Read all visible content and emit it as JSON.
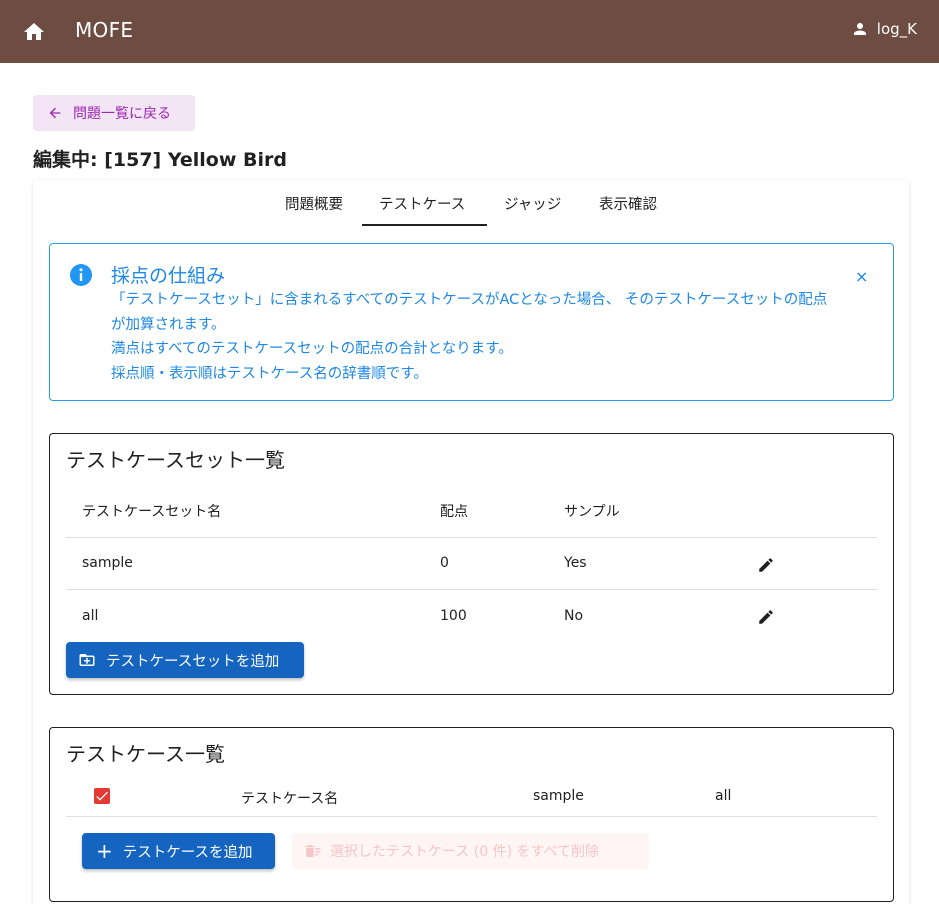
{
  "appbar": {
    "home_icon": "home-icon",
    "brand": "MOFE",
    "user_icon": "person-icon",
    "username": "log_K"
  },
  "back": {
    "icon": "arrow-left-icon",
    "label": "問題一覧に戻る"
  },
  "page_title": "編集中: [157] Yellow Bird",
  "tabs": [
    {
      "label": "問題概要",
      "active": false
    },
    {
      "label": "テストケース",
      "active": true
    },
    {
      "label": "ジャッジ",
      "active": false
    },
    {
      "label": "表示確認",
      "active": false
    }
  ],
  "alert": {
    "icon": "info-icon",
    "title": "採点の仕組み",
    "lines": [
      "「テストケースセット」に含まれるすべてのテストケースがACとなった場合、 そのテストケースセットの配点が加算されます。",
      "満点はすべてのテストケースセットの配点の合計となります。",
      "採点順・表示順はテストケース名の辞書順です。"
    ],
    "close": "×"
  },
  "testcase_sets": {
    "title": "テストケースセット一覧",
    "headers": [
      "テストケースセット名",
      "配点",
      "サンプル"
    ],
    "rows": [
      {
        "name": "sample",
        "score": "0",
        "sample": "Yes"
      },
      {
        "name": "all",
        "score": "100",
        "sample": "No"
      }
    ],
    "add_icon": "add-box-icon",
    "add_label": "テストケースセットを追加"
  },
  "testcases": {
    "title": "テストケース一覧",
    "headers": [
      "テストケース名",
      "sample",
      "all"
    ],
    "checkbox_checked": true,
    "add_label": "テストケースを追加",
    "delete_label": "選択したテストケース (0 件) をすべて削除"
  },
  "colors": {
    "appbar": "#6d4c41",
    "primary": "#1565c0",
    "info": "#1e88e5",
    "back_bg": "#f3e5f5",
    "back_fg": "#9c27b0",
    "checkbox": "#e53935"
  }
}
